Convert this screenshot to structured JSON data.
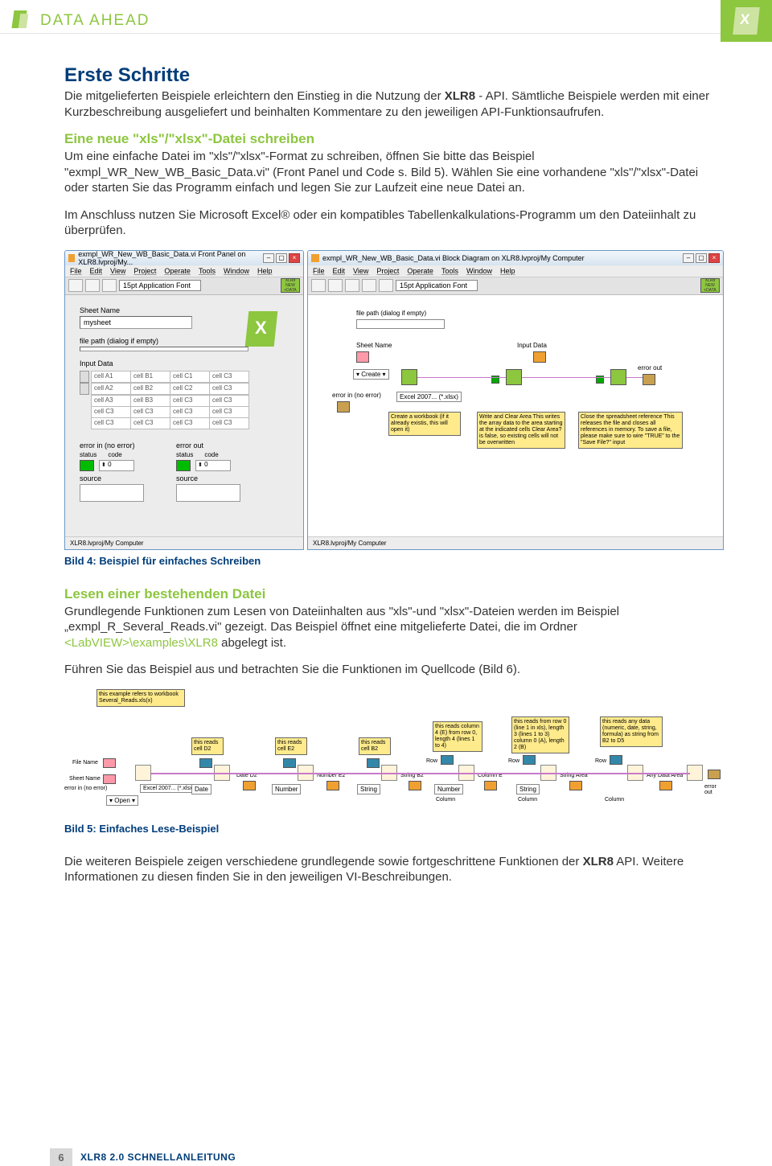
{
  "brand": "DATA AHEAD",
  "section1": {
    "title": "Erste Schritte",
    "p1a": "Die mitgelieferten Beispiele erleichtern den Einstieg in die Nutzung der ",
    "p1b": "XLR8",
    "p1c": " - API. Sämtliche Beispiele werden mit einer Kurzbeschreibung ausgeliefert und beinhalten Kommentare zu den jeweiligen API-Funktionsaufrufen."
  },
  "section2": {
    "title": "Eine neue \"xls\"/\"xlsx\"-Datei schreiben",
    "p1": "Um eine einfache Datei im \"xls\"/\"xlsx\"-Format zu schreiben, öffnen Sie bitte das Beispiel \"exmpl_WR_New_WB_Basic_Data.vi\" (Front Panel und Code s. Bild 5). Wählen Sie eine vorhandene \"xls\"/\"xlsx\"-Datei oder starten Sie das Programm einfach und legen Sie zur Laufzeit eine neue Datei an.",
    "p2": "Im Anschluss nutzen Sie Microsoft Excel® oder ein kompatibles Tabellenkalkulations-Programm um den Dateiinhalt zu überprüfen."
  },
  "fig1": {
    "left": {
      "title": "exmpl_WR_New_WB_Basic_Data.vi Front Panel on XLR8.lvproj/My...",
      "menu": [
        "File",
        "Edit",
        "View",
        "Project",
        "Operate",
        "Tools",
        "Window",
        "Help"
      ],
      "font": "15pt Application Font",
      "badge_top": "XLR8",
      "badge_mid": "NEW",
      "badge_bot": "+DATA",
      "sheet_label": "Sheet Name",
      "sheet_value": "mysheet",
      "file_label": "file path (dialog if empty)",
      "input_label": "Input Data",
      "table": [
        [
          "cell A1",
          "cell B1",
          "cell C1",
          "cell C3"
        ],
        [
          "cell A2",
          "cell B2",
          "cell C2",
          "cell C3"
        ],
        [
          "cell A3",
          "cell B3",
          "cell C3",
          "cell C3"
        ],
        [
          "cell C3",
          "cell C3",
          "cell C3",
          "cell C3"
        ],
        [
          "cell C3",
          "cell C3",
          "cell C3",
          "cell C3"
        ]
      ],
      "err_in_label": "error in (no error)",
      "err_out_label": "error out",
      "status": "status",
      "code": "code",
      "code_val": "0",
      "source": "source",
      "statusbar": "XLR8.lvproj/My Computer"
    },
    "right": {
      "title": "exmpl_WR_New_WB_Basic_Data.vi Block Diagram on XLR8.lvproj/My Computer",
      "menu": [
        "File",
        "Edit",
        "View",
        "Project",
        "Operate",
        "Tools",
        "Window",
        "Help"
      ],
      "font": "15pt Application Font",
      "file_label": "file path (dialog if empty)",
      "sheet_label": "Sheet Name",
      "input_label": "Input Data",
      "create": "Create",
      "excel_fmt": "Excel 2007... (*.xlsx)",
      "err_in": "error in (no error)",
      "err_out": "error out",
      "note1": "Create a workbook\n\n(if it already existis, this will open it)",
      "note2": "Write and Clear Area\n\nThis writes the array data to the area starting at the indicated cells\n\nClear Area? is false, so existing cells will not be overwritten",
      "note3": "Close the spreadsheet reference\n\nThis releases the file and closes all references in memory. To save a file, please make sure to wire \"TRUE\" to the \"Save File?\" input",
      "statusbar": "XLR8.lvproj/My Computer"
    },
    "caption": "Bild 4: Beispiel für einfaches Schreiben"
  },
  "section3": {
    "title": "Lesen einer bestehenden Datei",
    "p1a": "Grundlegende Funktionen zum Lesen von Dateiinhalten aus \"xls\"-und \"xlsx\"-Dateien werden im Beispiel „exmpl_R_Several_Reads.vi\" gezeigt. Das Beispiel öffnet eine mitgelieferte Datei, die im Ordner ",
    "path": "<LabVIEW>\\examples\\XLR8",
    "p1b": " abgelegt ist.",
    "p2": "Führen Sie das Beispiel aus und betrachten Sie die Funktionen im Quellcode (Bild 6)."
  },
  "fig2": {
    "note_top": "this example refers to workbook Several_Reads.xls(x)",
    "note_d2": "this reads cell D2",
    "note_e2": "this reads cell E2",
    "note_b2": "this reads cell B2",
    "note_colE": "this reads column 4 (E) from row 0, length 4 (lines 1 to 4)",
    "note_row0": "this reads from row 0 (line 1 in xls), length 3 (lines 1 to 3) column 0 (A), length 2 (B)",
    "note_any": "this reads any data (numeric, date, string, formula) as string from B2 to D5",
    "file_label": "File Name",
    "sheet_label": "Sheet Name",
    "err_in": "error in (no error)",
    "open": "Open",
    "excel_fmt": "Excel 2007... (*.xlsx)",
    "date": "Date",
    "number": "Number",
    "string": "String",
    "row": "Row",
    "column": "Column",
    "date_d2": "Date D2",
    "number_e2": "Number E2",
    "string_b2": "String B2",
    "column_e": "Column E",
    "string_area": "String Area",
    "any_area": "Any Data Area",
    "err_out": "error out",
    "caption": "Bild 5: Einfaches Lese-Beispiel"
  },
  "closing": {
    "p1a": "Die weiteren Beispiele zeigen verschiedene grundlegende sowie fortgeschrittene Funktionen der ",
    "p1b": "XLR8",
    "p1c": " API. Weitere Informationen zu diesen finden Sie in den jeweiligen VI-Beschreibungen."
  },
  "footer": {
    "page": "6",
    "title": "XLR8 2.0 SCHNELLANLEITUNG"
  }
}
